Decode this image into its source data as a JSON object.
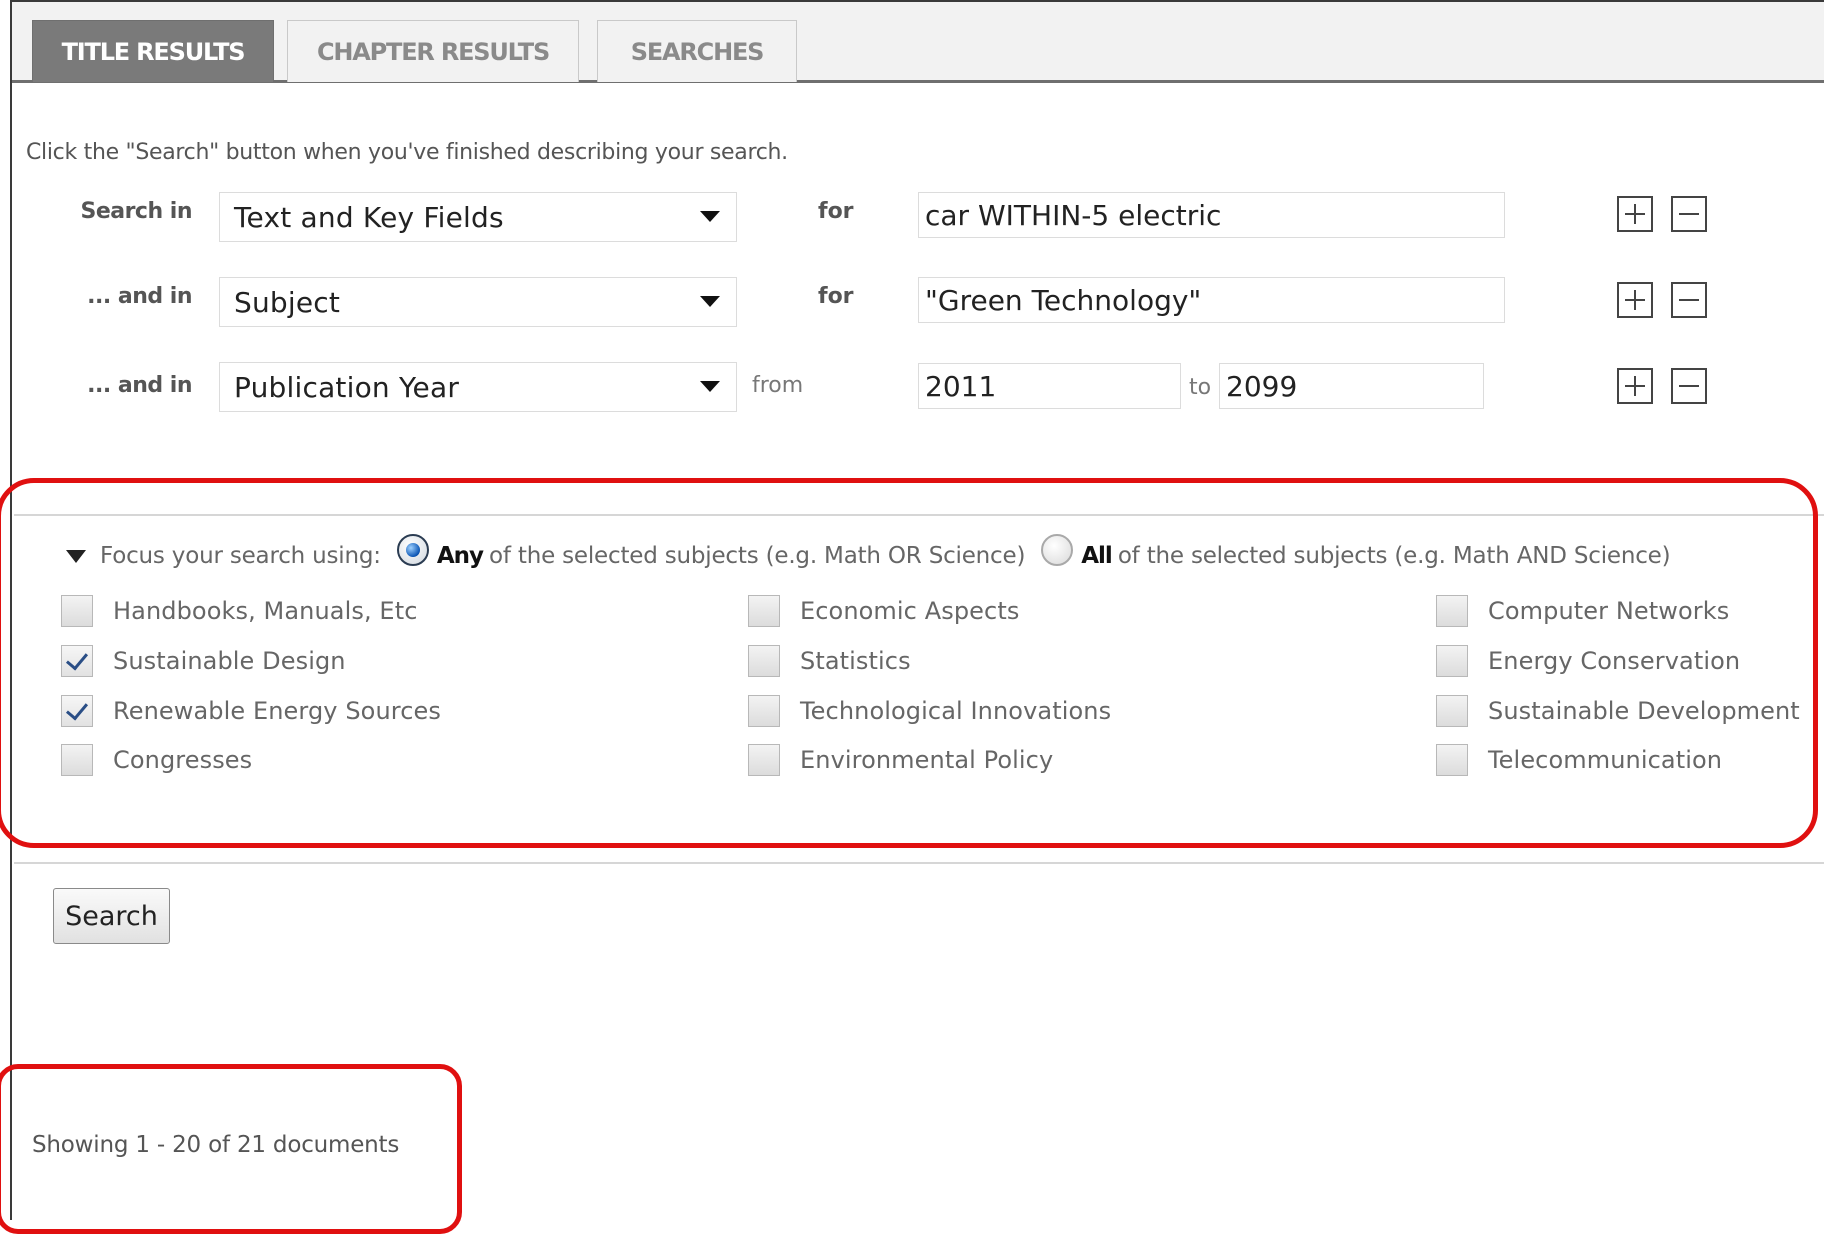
{
  "tabs": [
    {
      "label": "TITLE RESULTS",
      "active": true
    },
    {
      "label": "CHAPTER RESULTS",
      "active": false
    },
    {
      "label": "SEARCHES",
      "active": false
    }
  ],
  "instructions": "Click the \"Search\" button when you've finished describing your search.",
  "rows": [
    {
      "label": "Search in",
      "field": "Text and Key Fields",
      "connector": "for",
      "value": "car WITHIN-5 electric"
    },
    {
      "label": "... and in",
      "field": "Subject",
      "connector": "for",
      "value": "\"Green Technology\""
    },
    {
      "label": "... and in",
      "field": "Publication Year",
      "connector": "from",
      "from_value": "2011",
      "to_label": "to",
      "to_value": "2099"
    }
  ],
  "focus": {
    "lead": "Focus your search using:",
    "any_strong": "Any",
    "any_rest": "of the selected subjects (e.g. Math OR Science)",
    "all_strong": "All",
    "all_rest": "of the selected subjects (e.g. Math AND Science)",
    "selected_mode": "any",
    "subjects": [
      {
        "label": "Handbooks, Manuals, Etc",
        "checked": false
      },
      {
        "label": "Sustainable Design",
        "checked": true
      },
      {
        "label": "Renewable Energy Sources",
        "checked": true
      },
      {
        "label": "Congresses",
        "checked": false
      },
      {
        "label": "Economic Aspects",
        "checked": false
      },
      {
        "label": "Statistics",
        "checked": false
      },
      {
        "label": "Technological Innovations",
        "checked": false
      },
      {
        "label": "Environmental Policy",
        "checked": false
      },
      {
        "label": "Computer Networks",
        "checked": false
      },
      {
        "label": "Energy Conservation",
        "checked": false
      },
      {
        "label": "Sustainable Development",
        "checked": false
      },
      {
        "label": "Telecommunication",
        "checked": false
      }
    ]
  },
  "search_button": "Search",
  "results_summary": "Showing 1 - 20 of 21 documents",
  "colors": {
    "highlight": "#e01010",
    "active_tab": "#7a7a7a"
  }
}
